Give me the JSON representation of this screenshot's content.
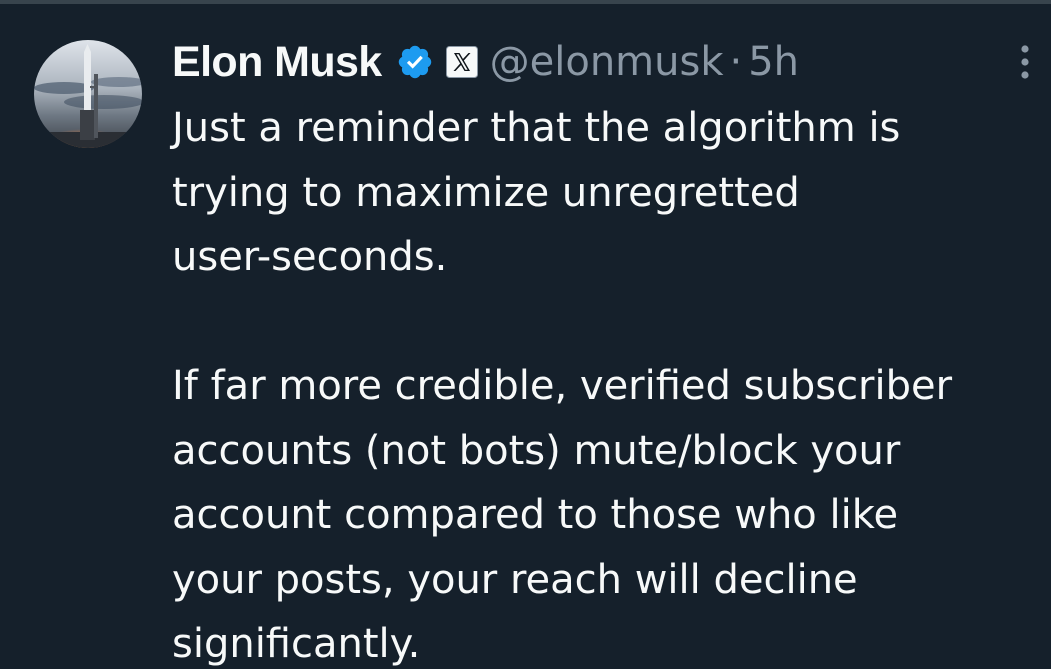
{
  "tweet": {
    "author": {
      "display_name": "Elon Musk",
      "handle": "@elonmusk",
      "verified_icon": "verified-badge-icon",
      "affiliation_icon": "x-logo-icon",
      "avatar": "rocket-launch-avatar"
    },
    "separator": "·",
    "timestamp": "5h",
    "more_icon": "more-vertical-icon",
    "paragraphs": [
      {
        "lines": [
          "Just a reminder that the algorithm is",
          "trying to maximize unregretted",
          "user-seconds."
        ]
      },
      {
        "lines": [
          "If far more credible, verified subscriber",
          "accounts (not bots) mute/block your",
          "account compared to those who like",
          "your posts, your reach will decline",
          "significantly."
        ]
      }
    ]
  },
  "colors": {
    "background": "#15202b",
    "text_primary": "#f7f9f9",
    "text_secondary": "#8b98a5",
    "verified_blue": "#1d9bf0",
    "divider": "#38444d"
  }
}
